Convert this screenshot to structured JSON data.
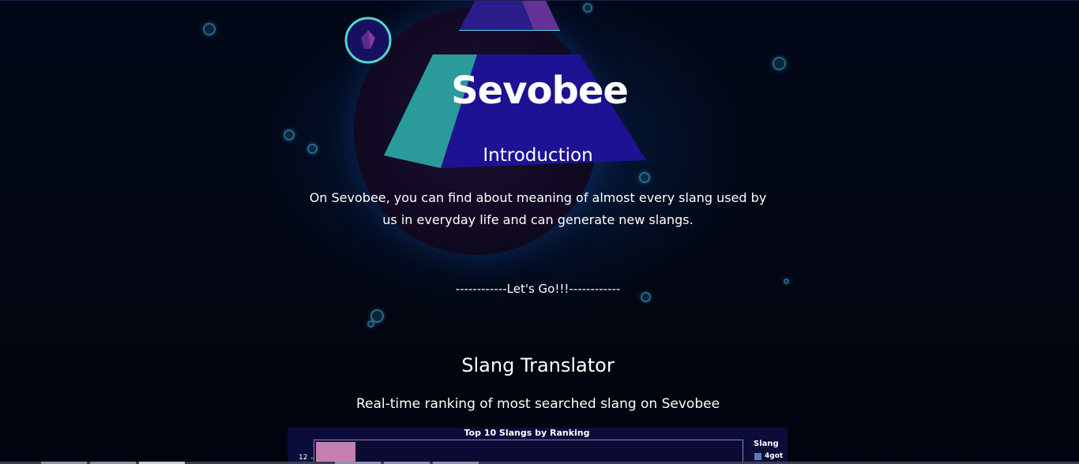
{
  "site": {
    "title": "Sevobee"
  },
  "intro": {
    "heading": "Introduction",
    "paragraph": "On Sevobee, you can find about meaning of almost every slang used by us in everyday life and can generate new slangs."
  },
  "cta": {
    "label": "------------Let's Go!!!------------"
  },
  "translator": {
    "heading": "Slang Translator",
    "ranking_text": "Real-time ranking of most searched slang on Sevobee"
  },
  "chart_data": {
    "type": "bar",
    "title": "Top 10 Slangs by Ranking",
    "legend_title": "Slang",
    "legend_position": "right",
    "categories": [
      "4got"
    ],
    "y_tick_labels": [
      "12"
    ],
    "colors": {
      "bar": "#c47fb0",
      "legend_swatch": "#5b7bb5",
      "background": "#0c0c3a"
    }
  },
  "icons": {
    "decorations": [
      "pyramid-shape",
      "ring-orb",
      "bubble"
    ]
  }
}
